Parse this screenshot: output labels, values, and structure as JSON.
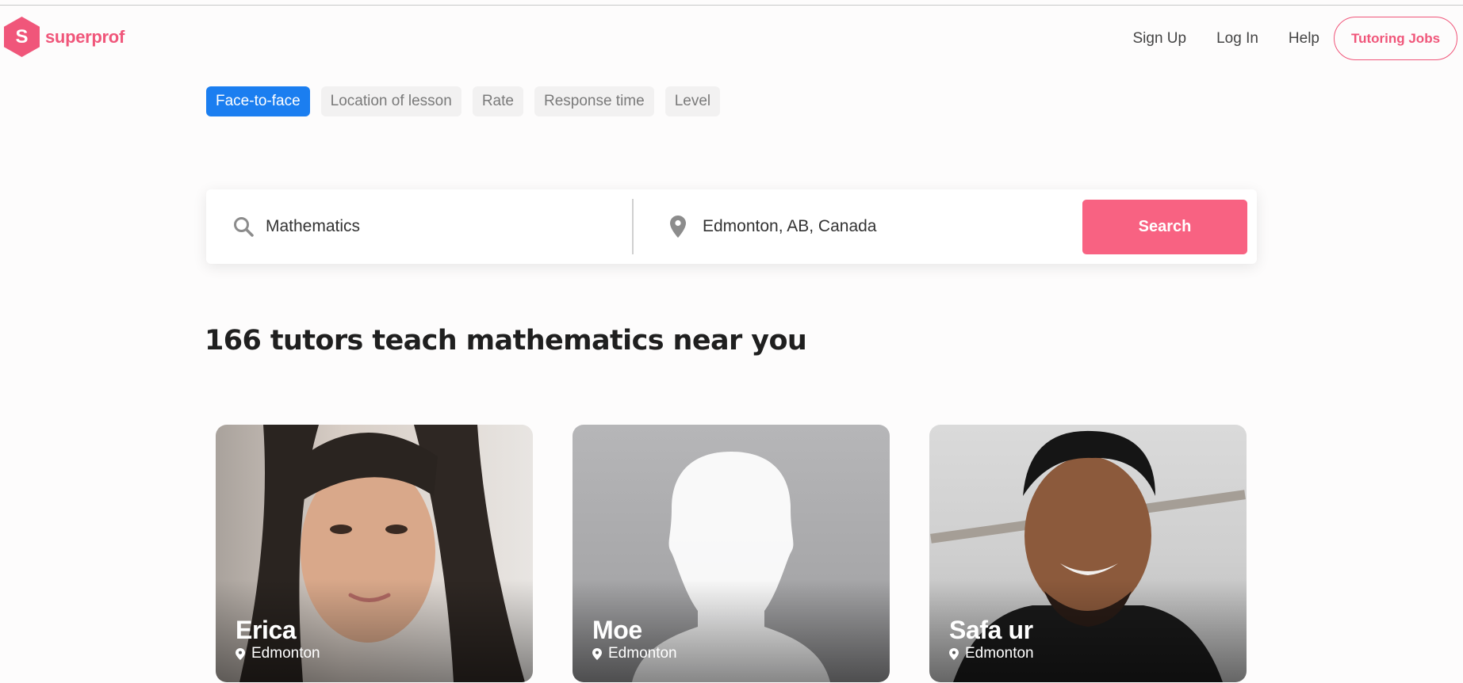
{
  "brand": {
    "logo_letter": "S",
    "name": "superprof",
    "accent": "#f0567a"
  },
  "nav": {
    "signup": "Sign Up",
    "login": "Log In",
    "help": "Help",
    "tutoring_jobs": "Tutoring Jobs"
  },
  "filters": [
    {
      "label": "Face-to-face",
      "active": true
    },
    {
      "label": "Location of lesson",
      "active": false
    },
    {
      "label": "Rate",
      "active": false
    },
    {
      "label": "Response time",
      "active": false
    },
    {
      "label": "Level",
      "active": false
    }
  ],
  "search": {
    "subject_value": "Mathematics",
    "subject_icon": "search-icon",
    "location_value": "Edmonton, AB, Canada",
    "location_icon": "map-pin-icon",
    "button_label": "Search",
    "button_color": "#f86282"
  },
  "results": {
    "title": "166 tutors teach mathematics near you"
  },
  "tutors": [
    {
      "name": "Erica",
      "city": "Edmonton",
      "photo": "tutor-photo"
    },
    {
      "name": "Moe",
      "city": "Edmonton",
      "photo": "default-avatar-silhouette"
    },
    {
      "name": "Safa ur",
      "city": "Edmonton",
      "photo": "tutor-photo"
    }
  ],
  "colors": {
    "filter_active": "#1b7ef0"
  }
}
